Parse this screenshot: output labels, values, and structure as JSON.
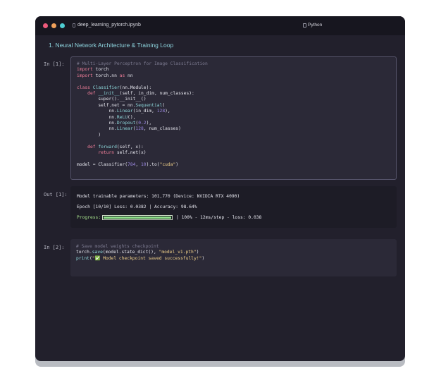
{
  "window": {
    "file_name": "deep_learning_pytorch.ipynb",
    "kernel": "Python"
  },
  "section": {
    "title": "1. Neural Network Architecture & Training Loop"
  },
  "cells": {
    "in1": {
      "prompt": "In [1]:",
      "lines": {
        "l1": "# Multi-Layer Perceptron for Image Classification",
        "l2_kw": "import",
        "l2": " torch",
        "l3_kw": "import",
        "l3a": " torch.nn ",
        "l3_as": "as",
        "l3b": " nn",
        "l5_kw": "class",
        "l5_fn": " Classifier",
        "l5": "(nn.Module):",
        "l6_kw": "    def",
        "l6_fn": " __init__",
        "l6": "(self, in_dim, num_classes):",
        "l7": "        super().__init__()",
        "l8a": "        self.net = nn.",
        "l8_fn": "Sequential",
        "l8b": "(",
        "l9a": "            nn.",
        "l9_fn": "Linear",
        "l9b": "(in_dim, ",
        "l9_nu": "128",
        "l9c": "),",
        "l10a": "            nn.",
        "l10_fn": "ReLU",
        "l10b": "(),",
        "l11a": "            nn.",
        "l11_fn": "Dropout",
        "l11b": "(",
        "l11_nu": "0.2",
        "l11c": "),",
        "l12a": "            nn.",
        "l12_fn": "Linear",
        "l12b": "(",
        "l12_nu": "128",
        "l12c": ", num_classes)",
        "l13": "        )",
        "l15_kw": "    def",
        "l15_fn": " forward",
        "l15": "(self, x):",
        "l16_kw": "        return",
        "l16": " self.net(x)",
        "l18a": "model = Classifier(",
        "l18_nu1": "784",
        "l18b": ", ",
        "l18_nu2": "10",
        "l18c": ").to(",
        "l18_st": "\"cuda\"",
        "l18d": ")"
      }
    },
    "out1": {
      "prompt": "Out [1]:",
      "params_line": "Model trainable parameters: 101,770 (Device: NVIDIA RTX 4090)",
      "epoch_line": "Epoch [10/10] Loss: 0.0382 | Accuracy: 98.64%",
      "progress_label": "Progress:",
      "progress_value": 1.0,
      "progress_rest": "| 100% - 12ms/step - loss: 0.038"
    },
    "in2": {
      "prompt": "In [2]:",
      "lines": {
        "l1": "# Save model weights checkpoint",
        "l2a": "torch.",
        "l2_fn": "save",
        "l2b": "(model.state_dict(), ",
        "l2_st": "\"model_v1.pth\"",
        "l2c": ")",
        "l3_fn": "print",
        "l3b": "(",
        "l3_st": "\"✅ Model checkpoint saved successfully!\"",
        "l3c": ")"
      }
    }
  }
}
